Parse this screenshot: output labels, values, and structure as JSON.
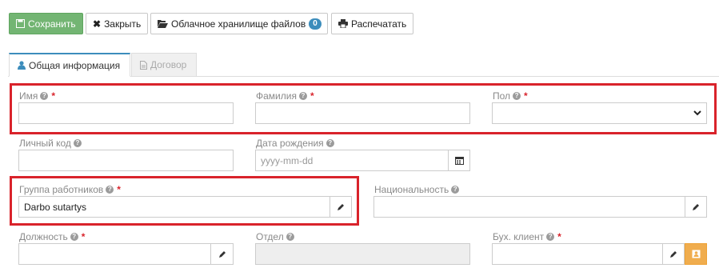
{
  "toolbar": {
    "save_label": "Сохранить",
    "close_label": "Закрыть",
    "cloud_label": "Облачное хранилище файлов",
    "cloud_count": "0",
    "print_label": "Распечатать"
  },
  "tabs": {
    "general_label": "Общая информация",
    "contract_label": "Договор"
  },
  "fields": {
    "first_name": {
      "label": "Имя",
      "value": ""
    },
    "last_name": {
      "label": "Фамилия",
      "value": ""
    },
    "gender": {
      "label": "Пол",
      "value": ""
    },
    "personal_code": {
      "label": "Личный код",
      "value": ""
    },
    "birth_date": {
      "label": "Дата рождения",
      "placeholder": "yyyy-mm-dd"
    },
    "employee_group": {
      "label": "Группа работников",
      "value": "Darbo sutartys"
    },
    "nationality": {
      "label": "Национальность",
      "value": ""
    },
    "position": {
      "label": "Должность",
      "value": ""
    },
    "department": {
      "label": "Отдел",
      "value": ""
    },
    "accounting_client": {
      "label": "Бух. клиент",
      "value": ""
    }
  },
  "colors": {
    "primary": "#73b573",
    "highlight": "#d9232b",
    "required": "#d9242c",
    "tab_accent": "#3c8dbc",
    "orange_button": "#f0ad4e"
  }
}
